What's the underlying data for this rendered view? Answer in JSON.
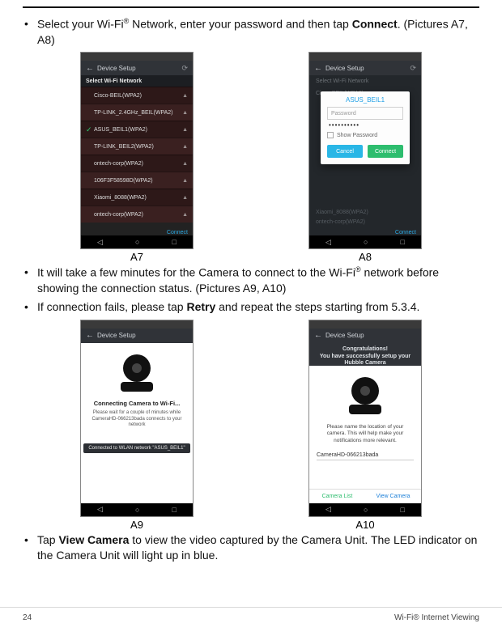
{
  "bullets": {
    "b1_pre": "Select your Wi-Fi",
    "b1_sup": "®",
    "b1_mid": " Network, enter your password and then tap ",
    "b1_bold": "Connect",
    "b1_post": ". (Pictures A7, A8)",
    "b2_pre": "It will take a few minutes for the Camera to connect to the Wi-Fi",
    "b2_sup": "®",
    "b2_post": " network before showing the connection status. (Pictures A9, A10)",
    "b3_pre": "If connection fails, please tap ",
    "b3_bold": "Retry",
    "b3_post": " and repeat the steps starting from 5.3.4.",
    "b4_pre": "Tap ",
    "b4_bold": "View Camera",
    "b4_post": " to view the video captured by the Camera Unit. The LED indicator on the Camera Unit will light up in blue."
  },
  "captions": {
    "a7": "A7",
    "a8": "A8",
    "a9": "A9",
    "a10": "A10"
  },
  "common": {
    "appbar_title": "Device Setup",
    "nav_back": "◁",
    "nav_home": "○",
    "nav_recent": "□",
    "refresh": "⟳",
    "back": "←"
  },
  "a7": {
    "select_header": "Select Wi-Fi Network",
    "networks": [
      "Cisco-BEIL(WPA2)",
      "TP-LINK_2.4GHz_BEIL(WPA2)",
      "ASUS_BEIL1(WPA2)",
      "TP-LINK_BEIL2(WPA2)",
      "ontech-corp(WPA2)",
      "106F3F58598D(WPA2)",
      "Xiaomi_8088(WPA2)",
      "ontech-corp(WPA2)"
    ],
    "selected_index": 2,
    "connect": "Connect"
  },
  "a8": {
    "select_header": "Select Wi-Fi Network",
    "faint_top": "Cisco-BEIL(WPA2)",
    "dialog_title": "ASUS_BEIL1",
    "password_label": "Password",
    "password_value": "••••••••••",
    "show_password": "Show Password",
    "cancel": "Cancel",
    "connect": "Connect",
    "faint1": "Xiaomi_8088(WPA2)",
    "faint2": "ontech-corp(WPA2)",
    "connect_bar": "Connect"
  },
  "a9": {
    "title": "Connecting Camera to Wi-Fi...",
    "sub": "Please wait for a couple of minutes while CameraHD-066213bada connects to your network",
    "pill": "Connected to WLAN network \"ASUS_BEIL1\""
  },
  "a10": {
    "congrats": "Congratulations!\nYou have successfully setup your Hubble Camera",
    "note": "Please name the location of your camera. This will help make your notifications more relevant.",
    "camname": "CameraHD-066213bada",
    "camera_list": "Camera List",
    "view_camera": "View Camera"
  },
  "footer": {
    "page": "24",
    "section": "Wi-Fi® Internet Viewing"
  }
}
